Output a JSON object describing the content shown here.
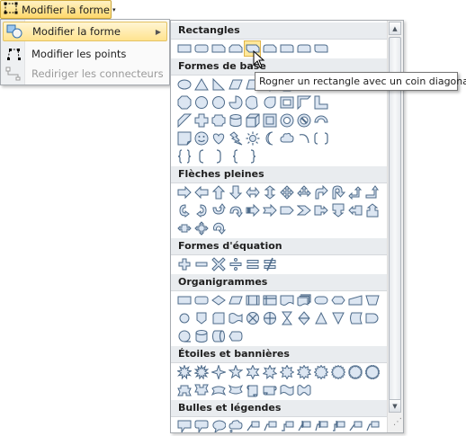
{
  "ribbon": {
    "button_label": "Modifier la forme",
    "dropdown_glyph": "▾",
    "icon": "edit-shape-icon"
  },
  "menu": {
    "items": [
      {
        "label": "Modifier la forme",
        "icon": "change-shape-icon",
        "highlighted": true,
        "has_submenu": true,
        "disabled": false
      },
      {
        "label": "Modifier les points",
        "icon": "edit-points-icon",
        "highlighted": false,
        "has_submenu": false,
        "disabled": false
      },
      {
        "label": "Rediriger les connecteurs",
        "icon": "reroute-connectors-icon",
        "highlighted": false,
        "has_submenu": false,
        "disabled": true
      }
    ],
    "submenu_glyph": "▶"
  },
  "gallery": {
    "selected": {
      "section": 0,
      "index": 4
    },
    "sections": [
      {
        "title": "Rectangles",
        "rows": [
          [
            "rect",
            "round-rect",
            "snip1",
            "snip2",
            "snip-diag",
            "snip-round",
            "round1",
            "round2",
            "round-diag"
          ]
        ]
      },
      {
        "title": "Formes de base",
        "rows": [
          [
            "oval",
            "tri",
            "rtri",
            "para",
            "trap",
            "diamond",
            "pent",
            "hex",
            "hept"
          ],
          [
            "oct",
            "dec",
            "dodec",
            "pie",
            "chord",
            "tear",
            "frame",
            "half-frame",
            "l-shape"
          ],
          [
            "diag-stripe",
            "plus",
            "plaque",
            "can",
            "cube",
            "bevel",
            "donut",
            "no",
            "block-arc"
          ],
          [
            "folded",
            "smiley",
            "heart",
            "bolt",
            "sun",
            "moon",
            "cloud",
            "arc",
            "dbrkt"
          ],
          [
            "dbrace",
            "lbrkt",
            "rbrkt",
            "lbrace",
            "rbrace"
          ]
        ]
      },
      {
        "title": "Flèches pleines",
        "rows": [
          [
            "a-right",
            "a-left",
            "a-up",
            "a-down",
            "a-lr",
            "a-ud",
            "a-quad",
            "a-lru",
            "a-bent",
            "a-uturn",
            "a-lup",
            "a-bentup"
          ],
          [
            "a-curv-r",
            "a-curv-l",
            "a-curv-u",
            "a-curv-d",
            "a-striped",
            "a-notched",
            "pentagon-a",
            "chevron",
            "a-right-call",
            "a-down-call",
            "a-left-call",
            "a-up-call"
          ],
          [
            "a-lr-call",
            "a-quad-call",
            "a-circ"
          ]
        ]
      },
      {
        "title": "Formes d'équation",
        "rows": [
          [
            "m-plus",
            "m-minus",
            "m-mult",
            "m-div",
            "m-eq",
            "m-neq"
          ]
        ]
      },
      {
        "title": "Organigrammes",
        "rows": [
          [
            "f-process",
            "f-alt",
            "f-decision",
            "f-data",
            "f-predef",
            "f-internal",
            "f-doc",
            "f-multidoc",
            "f-term",
            "f-prep",
            "f-manual-in",
            "f-manual-op"
          ],
          [
            "f-conn",
            "f-offpage",
            "f-card",
            "f-tape",
            "f-sumj",
            "f-or",
            "f-collate",
            "f-sort",
            "f-extract",
            "f-merge",
            "f-stored",
            "f-delay"
          ],
          [
            "f-seq",
            "f-magdisk",
            "f-direct",
            "f-display"
          ]
        ]
      },
      {
        "title": "Étoiles et bannières",
        "rows": [
          [
            "s-explo1",
            "s-explo2",
            "s-4",
            "s-5",
            "s-6",
            "s-7",
            "s-8",
            "s-10",
            "s-12",
            "s-16",
            "s-24",
            "s-32"
          ],
          [
            "b-ribbon-up",
            "b-ribbon-down",
            "b-ribbon-curv-up",
            "b-ribbon-curv-down",
            "b-scroll-v",
            "b-scroll-h",
            "b-wave",
            "b-dwave"
          ]
        ]
      },
      {
        "title": "Bulles et légendes",
        "rows": [
          [
            "c-rect",
            "c-rrect",
            "c-oval",
            "c-cloud",
            "c-line1",
            "c-line2",
            "c-line3",
            "c-acc1",
            "c-acc2",
            "c-acc3",
            "c-bor1",
            "c-bor2"
          ],
          [
            "c-bor3",
            "c-ab1",
            "c-ab2",
            "c-ab3"
          ]
        ]
      }
    ]
  },
  "tooltip": {
    "text": "Rogner un rectangle avec un coin diagonal"
  },
  "scrollbar": {
    "up_glyph": "▲",
    "down_glyph": "▼"
  },
  "resize_grip": "⋰"
}
